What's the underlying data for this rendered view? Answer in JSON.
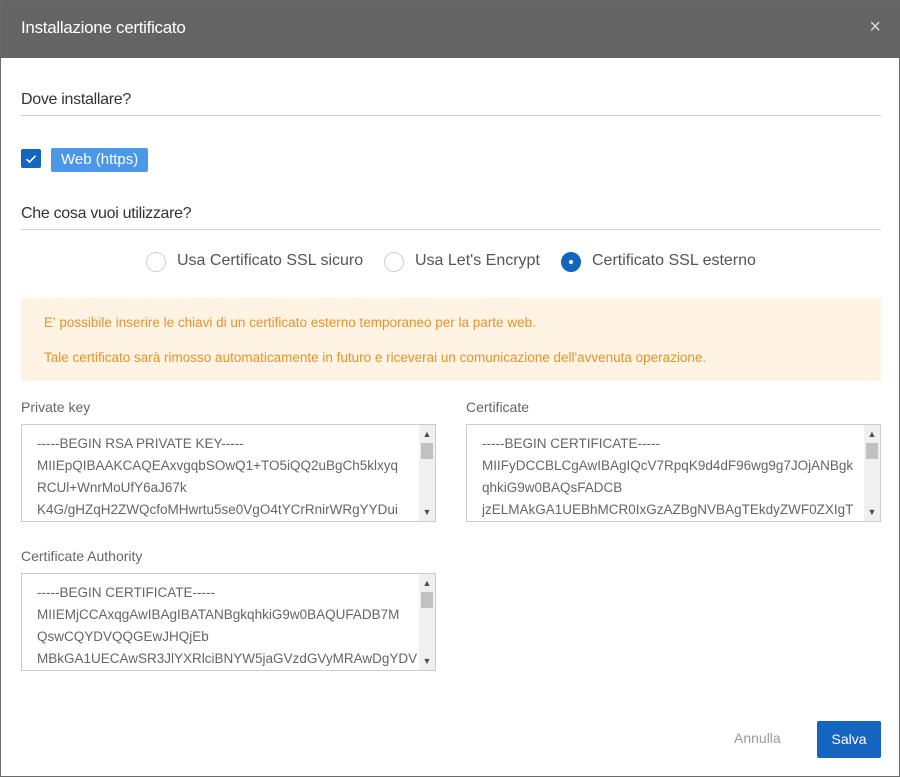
{
  "dialog": {
    "title": "Installazione certificato",
    "close_glyph": "×"
  },
  "where": {
    "heading": "Dove installare?",
    "web_option": {
      "label": "Web (https)",
      "checked": true
    }
  },
  "what": {
    "heading": "Che cosa vuoi utilizzare?",
    "radios": [
      {
        "label": "Usa Certificato SSL sicuro",
        "selected": false
      },
      {
        "label": "Usa Let's Encrypt",
        "selected": false
      },
      {
        "label": "Certificato SSL esterno",
        "selected": true
      }
    ]
  },
  "alert": {
    "line1": "E' possibile inserire le chiavi di un certificato esterno temporaneo per la parte web.",
    "line2": "Tale certificato sarà rimosso automaticamente in futuro e riceverai un comunicazione dell'avvenuta operazione."
  },
  "private_key": {
    "label": "Private key",
    "lines": [
      "-----BEGIN RSA PRIVATE KEY-----",
      "MIIEpQIBAAKCAQEAxvgqbSOwQ1+TO5iQQ2uBgCh5klxyq",
      "RCUl+WnrMoUfY6aJ67k",
      "K4G/gHZqH2ZWQcfoMHwrtu5se0VgO4tYCrRnirWRgYYDui"
    ]
  },
  "certificate": {
    "label": "Certificate",
    "lines": [
      "-----BEGIN CERTIFICATE-----",
      "MIIFyDCCBLCgAwIBAgIQcV7RpqK9d4dF96wg9g7JOjANBgk",
      "qhkiG9w0BAQsFADCB",
      "jzELMAkGA1UEBhMCR0IxGzAZBgNVBAgTEkdyZWF0ZXIgT"
    ]
  },
  "ca": {
    "label": "Certificate Authority",
    "lines": [
      "-----BEGIN CERTIFICATE-----",
      "MIIEMjCCAxqgAwIBAgIBATANBgkqhkiG9w0BAQUFADB7M",
      "QswCQYDVQQGEwJHQjEb",
      "MBkGA1UECAwSR3JlYXRlciBNYW5jaGVzdGVyMRAwDgYDV"
    ]
  },
  "buttons": {
    "cancel": "Annulla",
    "save": "Salva"
  },
  "scroll_arrows": {
    "up": "▲",
    "down": "▼"
  },
  "colors": {
    "titlebar": "#646464",
    "primary": "#1565c0",
    "chip": "#4b98e8",
    "alert_bg": "#fff3e4",
    "alert_text": "#e5932a"
  }
}
